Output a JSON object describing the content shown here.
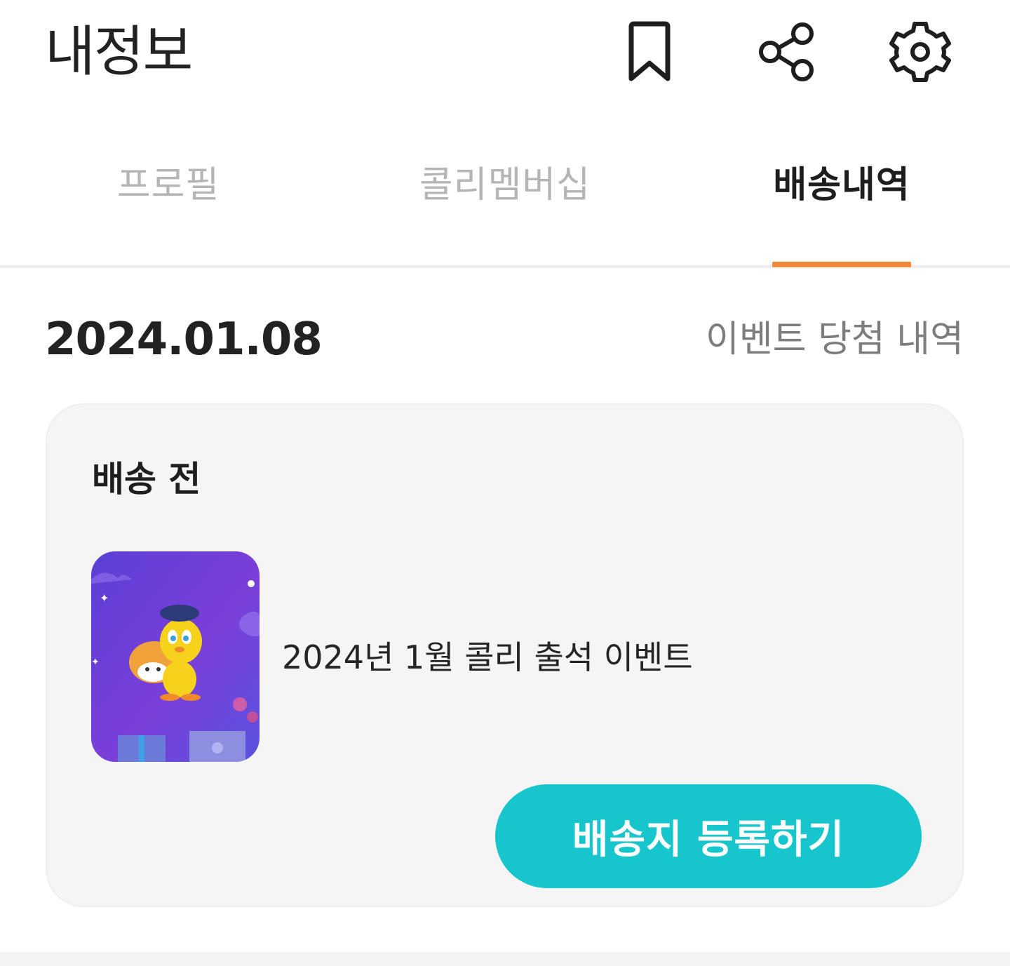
{
  "header": {
    "title": "내정보",
    "icons": [
      "bookmark-icon",
      "share-icon",
      "settings-gear-icon"
    ]
  },
  "tabs": [
    {
      "label": "프로필",
      "active": false
    },
    {
      "label": "콜리멤버십",
      "active": false
    },
    {
      "label": "배송내역",
      "active": true
    }
  ],
  "delivery": {
    "date": "2024.01.08",
    "event_link": "이벤트 당첨 내역",
    "card": {
      "status": "배송 전",
      "item_name": "2024년 1월 콜리 출석 이벤트",
      "thumbnail_icon": "event-prize-image",
      "button_label": "배송지 등록하기"
    }
  },
  "colors": {
    "accent_orange": "#f08a3a",
    "button_teal": "#16c6cc",
    "card_background": "#f5f5f5",
    "inactive_tab_text": "#b5b5b5"
  }
}
